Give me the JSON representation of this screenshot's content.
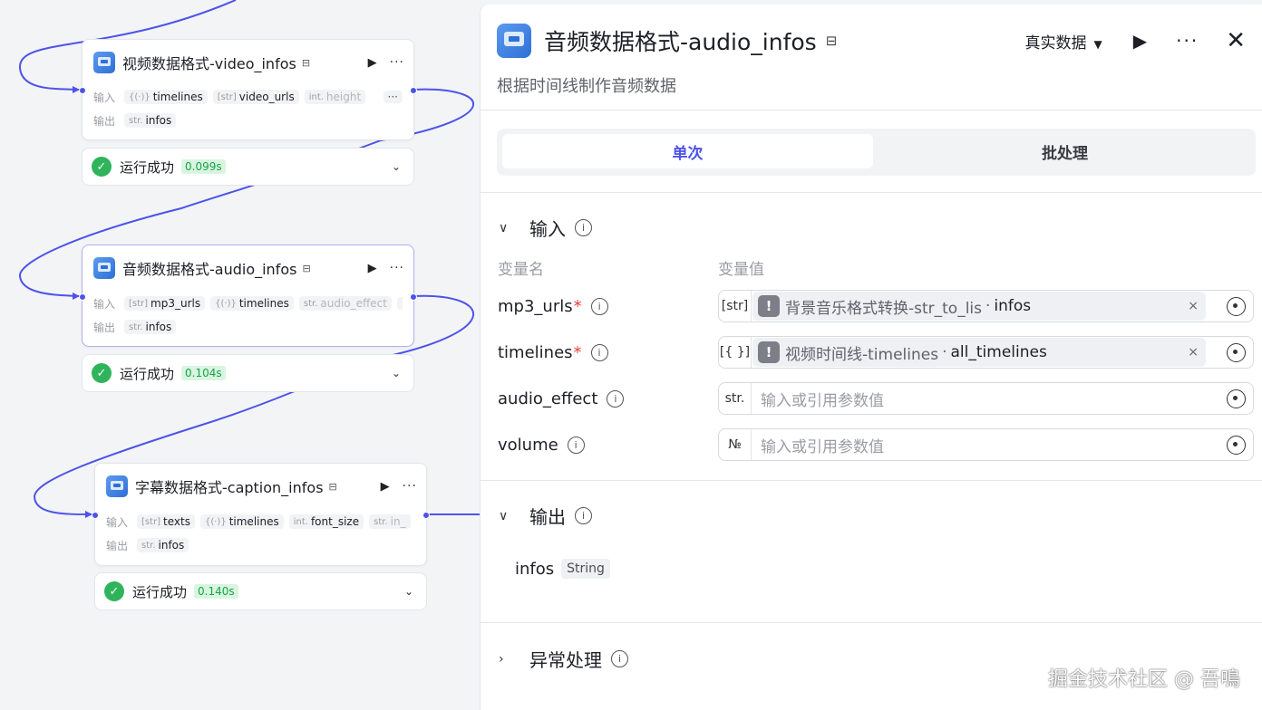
{
  "canvas": {
    "nodes": [
      {
        "title": "视频数据格式-video_infos",
        "input_label": "输入",
        "output_label": "输出",
        "inputs": [
          {
            "type": "{(·)}",
            "name": "timelines"
          },
          {
            "type": "[str]",
            "name": "video_urls"
          },
          {
            "type": "int.",
            "name": "height"
          }
        ],
        "more": "···",
        "outputs": [
          {
            "type": "str.",
            "name": "infos"
          }
        ],
        "status": "运行成功",
        "time": "0.099s"
      },
      {
        "title": "音频数据格式-audio_infos",
        "input_label": "输入",
        "output_label": "输出",
        "inputs": [
          {
            "type": "[str]",
            "name": "mp3_urls"
          },
          {
            "type": "{(·)}",
            "name": "timelines"
          },
          {
            "type": "str.",
            "name": "audio_effect"
          }
        ],
        "more": "···",
        "outputs": [
          {
            "type": "str.",
            "name": "infos"
          }
        ],
        "status": "运行成功",
        "time": "0.104s"
      },
      {
        "title": "字幕数据格式-caption_infos",
        "input_label": "输入",
        "output_label": "输出",
        "inputs": [
          {
            "type": "[str]",
            "name": "texts"
          },
          {
            "type": "{(·)}",
            "name": "timelines"
          },
          {
            "type": "int.",
            "name": "font_size"
          },
          {
            "type": "str.",
            "name": "in_"
          }
        ],
        "more": "···",
        "outputs": [
          {
            "type": "str.",
            "name": "infos"
          }
        ],
        "status": "运行成功",
        "time": "0.140s"
      }
    ]
  },
  "panel": {
    "title": "音频数据格式-audio_infos",
    "mode": "真实数据",
    "description": "根据时间线制作音频数据",
    "tabs": [
      "单次",
      "批处理"
    ],
    "input_section": "输入",
    "col_name": "变量名",
    "col_value": "变量值",
    "vars": [
      {
        "name": "mp3_urls",
        "required": "*",
        "type": "[str]",
        "source": "背景音乐格式转换-str_to_lis",
        "key": "infos"
      },
      {
        "name": "timelines",
        "required": "*",
        "type": "[{ }]",
        "source": "视频时间线-timelines",
        "key": "all_timelines"
      },
      {
        "name": "audio_effect",
        "type": "str.",
        "placeholder": "输入或引用参数值"
      },
      {
        "name": "volume",
        "type": "№",
        "placeholder": "输入或引用参数值"
      }
    ],
    "output_section": "输出",
    "output": {
      "name": "infos",
      "type": "String"
    },
    "error_section": "异常处理"
  },
  "watermark": "掘金技术社区 @ 吾鳴",
  "colors": {
    "accent": "#4d53e8",
    "success": "#2fb45b",
    "required": "#e5403a"
  }
}
